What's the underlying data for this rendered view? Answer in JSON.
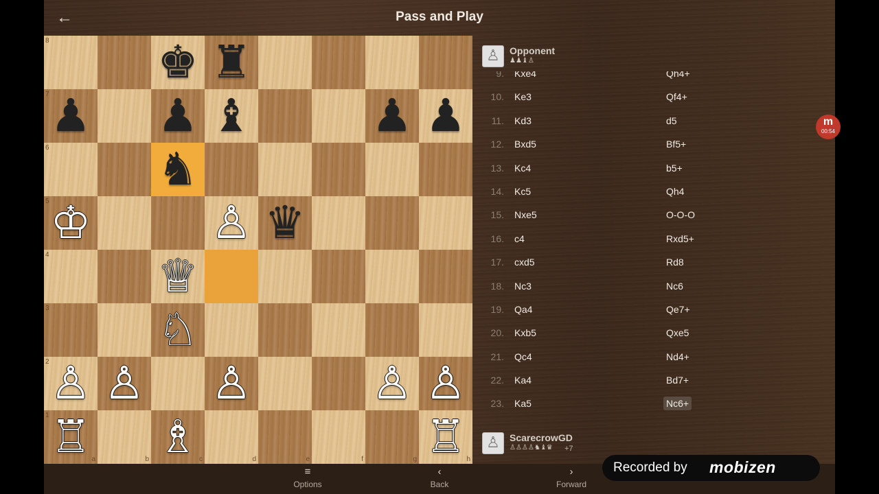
{
  "header": {
    "title": "Pass and Play",
    "back_icon": "←"
  },
  "board": {
    "files": [
      "a",
      "b",
      "c",
      "d",
      "e",
      "f",
      "g",
      "h"
    ],
    "ranks": [
      "8",
      "7",
      "6",
      "5",
      "4",
      "3",
      "2",
      "1"
    ],
    "highlight_from": "d4",
    "highlight_to": "c6",
    "pieces": [
      {
        "sq": "c8",
        "color": "b",
        "type": "king",
        "glyph": "♚"
      },
      {
        "sq": "d8",
        "color": "b",
        "type": "rook",
        "glyph": "♜"
      },
      {
        "sq": "a7",
        "color": "b",
        "type": "pawn",
        "glyph": "♟"
      },
      {
        "sq": "c7",
        "color": "b",
        "type": "pawn",
        "glyph": "♟"
      },
      {
        "sq": "d7",
        "color": "b",
        "type": "bishop",
        "glyph": "♝"
      },
      {
        "sq": "g7",
        "color": "b",
        "type": "pawn",
        "glyph": "♟"
      },
      {
        "sq": "h7",
        "color": "b",
        "type": "pawn",
        "glyph": "♟"
      },
      {
        "sq": "c6",
        "color": "b",
        "type": "knight",
        "glyph": "♞"
      },
      {
        "sq": "a5",
        "color": "w",
        "type": "king",
        "glyph": "♔"
      },
      {
        "sq": "d5",
        "color": "w",
        "type": "pawn",
        "glyph": "♙"
      },
      {
        "sq": "e5",
        "color": "b",
        "type": "queen",
        "glyph": "♛"
      },
      {
        "sq": "c4",
        "color": "w",
        "type": "queen",
        "glyph": "♕"
      },
      {
        "sq": "c3",
        "color": "w",
        "type": "knight",
        "glyph": "♘"
      },
      {
        "sq": "a2",
        "color": "w",
        "type": "pawn",
        "glyph": "♙"
      },
      {
        "sq": "b2",
        "color": "w",
        "type": "pawn",
        "glyph": "♙"
      },
      {
        "sq": "d2",
        "color": "w",
        "type": "pawn",
        "glyph": "♙"
      },
      {
        "sq": "g2",
        "color": "w",
        "type": "pawn",
        "glyph": "♙"
      },
      {
        "sq": "h2",
        "color": "w",
        "type": "pawn",
        "glyph": "♙"
      },
      {
        "sq": "a1",
        "color": "w",
        "type": "rook",
        "glyph": "♖"
      },
      {
        "sq": "c1",
        "color": "w",
        "type": "bishop",
        "glyph": "♗"
      },
      {
        "sq": "h1",
        "color": "w",
        "type": "rook",
        "glyph": "♖"
      }
    ]
  },
  "opponent": {
    "name": "Opponent",
    "captured": "♟♟♝♙",
    "avatar_icon": "♙"
  },
  "player": {
    "name": "ScarecrowGD",
    "captured": "♙♙♙♙♞♝♛",
    "material": "+7",
    "avatar_icon": "♙"
  },
  "moves": [
    {
      "num": "9.",
      "white": "Kxe4",
      "black": "Qh4+"
    },
    {
      "num": "10.",
      "white": "Ke3",
      "black": "Qf4+"
    },
    {
      "num": "11.",
      "white": "Kd3",
      "black": "d5"
    },
    {
      "num": "12.",
      "white": "Bxd5",
      "black": "Bf5+"
    },
    {
      "num": "13.",
      "white": "Kc4",
      "black": "b5+"
    },
    {
      "num": "14.",
      "white": "Kc5",
      "black": "Qh4"
    },
    {
      "num": "15.",
      "white": "Nxe5",
      "black": "O-O-O"
    },
    {
      "num": "16.",
      "white": "c4",
      "black": "Rxd5+"
    },
    {
      "num": "17.",
      "white": "cxd5",
      "black": "Rd8"
    },
    {
      "num": "18.",
      "white": "Nc3",
      "black": "Nc6"
    },
    {
      "num": "19.",
      "white": "Qa4",
      "black": "Qe7+"
    },
    {
      "num": "20.",
      "white": "Kxb5",
      "black": "Qxe5"
    },
    {
      "num": "21.",
      "white": "Qc4",
      "black": "Nd4+"
    },
    {
      "num": "22.",
      "white": "Ka4",
      "black": "Bd7+"
    },
    {
      "num": "23.",
      "white": "Ka5",
      "black": "Nc6+",
      "current": true
    }
  ],
  "bottom_nav": {
    "options": {
      "label": "Options",
      "icon": "≡"
    },
    "back": {
      "label": "Back",
      "icon": "‹"
    },
    "forward": {
      "label": "Forward",
      "icon": "›"
    }
  },
  "overlay": {
    "recorded_by": "Recorded by",
    "brand": "mobizen",
    "bubble_letter": "m",
    "bubble_time": "00:54"
  }
}
